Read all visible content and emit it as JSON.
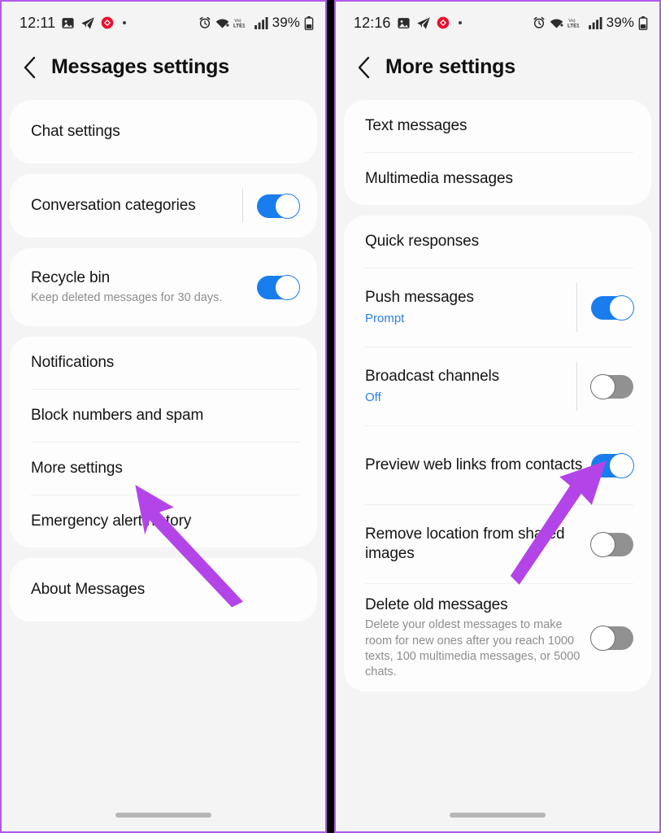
{
  "annotation": {
    "arrow_color": "#b344e8",
    "arrow_count": 2
  },
  "theme": {
    "accent_blue": "#1a7ded",
    "link_blue": "#2f7ee8",
    "toggle_off": "#919191",
    "page_bg": "#f4f4f4",
    "card_bg": "#fdfdfd",
    "panel_border": "#b15ae8"
  },
  "left_panel": {
    "status_bar": {
      "time": "12:11",
      "left_icons": [
        "photo-icon",
        "telegram-icon",
        "alert-badge-icon",
        "dot-icon"
      ],
      "right_icons": [
        "alarm-icon",
        "wifi-icon",
        "volte-lte1-icon",
        "signal-bars-icon",
        "battery-icon"
      ],
      "battery_percent": "39%"
    },
    "title": "Messages settings",
    "back_icon": "back-chevron-icon",
    "groups": [
      {
        "rows": [
          {
            "title": "Chat settings",
            "type": "nav"
          }
        ]
      },
      {
        "rows": [
          {
            "title": "Conversation categories",
            "type": "toggle",
            "toggle": "on",
            "separator": true
          }
        ]
      },
      {
        "rows": [
          {
            "title": "Recycle bin",
            "subtitle": "Keep deleted messages for 30 days.",
            "type": "toggle",
            "toggle": "on",
            "separator": false
          }
        ]
      },
      {
        "rows": [
          {
            "title": "Notifications",
            "type": "nav"
          },
          {
            "title": "Block numbers and spam",
            "type": "nav"
          },
          {
            "title": "More settings",
            "type": "nav"
          },
          {
            "title": "Emergency alert history",
            "type": "nav"
          }
        ]
      },
      {
        "rows": [
          {
            "title": "About Messages",
            "type": "nav"
          }
        ]
      }
    ]
  },
  "right_panel": {
    "status_bar": {
      "time": "12:16",
      "left_icons": [
        "photo-icon",
        "telegram-icon",
        "alert-badge-icon",
        "dot-icon"
      ],
      "right_icons": [
        "alarm-icon",
        "wifi-icon",
        "volte-lte1-icon",
        "signal-bars-icon",
        "battery-icon"
      ],
      "battery_percent": "39%"
    },
    "title": "More settings",
    "back_icon": "back-chevron-icon",
    "groups": [
      {
        "rows": [
          {
            "title": "Text messages",
            "type": "nav"
          },
          {
            "title": "Multimedia messages",
            "type": "nav"
          }
        ]
      },
      {
        "rows": [
          {
            "title": "Quick responses",
            "type": "nav"
          },
          {
            "title": "Push messages",
            "subtitle": "Prompt",
            "subtitle_style": "accent",
            "type": "toggle",
            "toggle": "on",
            "separator": true
          },
          {
            "title": "Broadcast channels",
            "subtitle": "Off",
            "subtitle_style": "accent",
            "type": "toggle",
            "toggle": "off",
            "separator": true
          },
          {
            "title": "Preview web links from contacts",
            "type": "toggle",
            "toggle": "on",
            "separator": false
          },
          {
            "title": "Remove location from shared images",
            "type": "toggle",
            "toggle": "off",
            "separator": false
          },
          {
            "title": "Delete old messages",
            "subtitle": "Delete your oldest messages to make room for new ones after you reach 1000 texts, 100 multimedia messages, or 5000 chats.",
            "type": "toggle",
            "toggle": "off",
            "separator": false
          }
        ]
      }
    ]
  }
}
